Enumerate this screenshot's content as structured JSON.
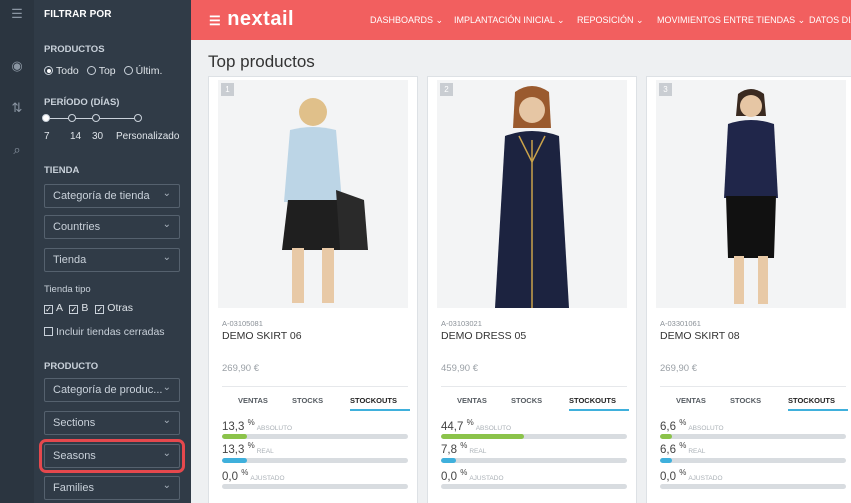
{
  "colors": {
    "brand": "#f25f5f",
    "sidebar": "#303b47",
    "rail": "#2b3540",
    "highlight": "#e5484d",
    "bar_green": "#8bc34a",
    "bar_blue": "#3fb0dc",
    "bar_track": "#d8dce0"
  },
  "rail_icons": [
    "sliders-icon",
    "eye-icon",
    "sort-icon",
    "search-icon"
  ],
  "sidebar": {
    "heading": "FILTRAR POR",
    "productos": {
      "label": "PRODUCTOS",
      "options": [
        "Todo",
        "Top",
        "Últim."
      ],
      "selected": "Todo"
    },
    "periodo": {
      "label": "PERÍODO (DÍAS)",
      "ticks": [
        "7",
        "14",
        "30",
        "Personalizado"
      ],
      "selected": "7"
    },
    "tienda": {
      "label": "TIENDA",
      "selects": [
        "Categoría de tienda",
        "Countries",
        "Tienda"
      ],
      "tipo_label": "Tienda tipo",
      "tipo_options": [
        "A",
        "B",
        "Otras"
      ],
      "closed_label": "Incluir tiendas cerradas"
    },
    "producto": {
      "label": "PRODUCTO",
      "selects": [
        "Categoría de produc...",
        "Sections",
        "Seasons",
        "Families"
      ]
    }
  },
  "topbar": {
    "logo": "nextail",
    "nav": [
      "DASHBOARDS ⌄",
      "IMPLANTACIÓN INICIAL ⌄",
      "REPOSICIÓN ⌄",
      "MOVIMIENTOS ENTRE TIENDAS ⌄",
      "DATOS DIA"
    ]
  },
  "page_title": "Top productos",
  "products": [
    {
      "rank": "1",
      "code": "A-03105081",
      "name": "DEMO SKIRT 06",
      "price": "269,90 €",
      "tabs": [
        "VENTAS",
        "STOCKS",
        "STOCKOUTS"
      ],
      "active_tab": "STOCKOUTS",
      "metrics": [
        {
          "value": "13,3",
          "unit": "%",
          "label": "ABSOLUTO",
          "fill": 0.133,
          "color": "#8bc34a"
        },
        {
          "value": "13,3",
          "unit": "%",
          "label": "REAL",
          "fill": 0.133,
          "color": "#3fb0dc"
        },
        {
          "value": "0,0",
          "unit": "%",
          "label": "AJUSTADO",
          "fill": 0.0,
          "color": "#3fb0dc"
        }
      ]
    },
    {
      "rank": "2",
      "code": "A-03103021",
      "name": "DEMO DRESS 05",
      "price": "459,90 €",
      "tabs": [
        "VENTAS",
        "STOCKS",
        "STOCKOUTS"
      ],
      "active_tab": "STOCKOUTS",
      "metrics": [
        {
          "value": "44,7",
          "unit": "%",
          "label": "ABSOLUTO",
          "fill": 0.447,
          "color": "#8bc34a"
        },
        {
          "value": "7,8",
          "unit": "%",
          "label": "REAL",
          "fill": 0.078,
          "color": "#3fb0dc"
        },
        {
          "value": "0,0",
          "unit": "%",
          "label": "AJUSTADO",
          "fill": 0.0,
          "color": "#3fb0dc"
        }
      ]
    },
    {
      "rank": "3",
      "code": "A-03301061",
      "name": "DEMO SKIRT 08",
      "price": "269,90 €",
      "tabs": [
        "VENTAS",
        "STOCKS",
        "STOCKOUTS"
      ],
      "active_tab": "STOCKOUTS",
      "metrics": [
        {
          "value": "6,6",
          "unit": "%",
          "label": "ABSOLUTO",
          "fill": 0.066,
          "color": "#8bc34a"
        },
        {
          "value": "6,6",
          "unit": "%",
          "label": "REAL",
          "fill": 0.066,
          "color": "#3fb0dc"
        },
        {
          "value": "0,0",
          "unit": "%",
          "label": "AJUSTADO",
          "fill": 0.0,
          "color": "#3fb0dc"
        }
      ]
    }
  ]
}
